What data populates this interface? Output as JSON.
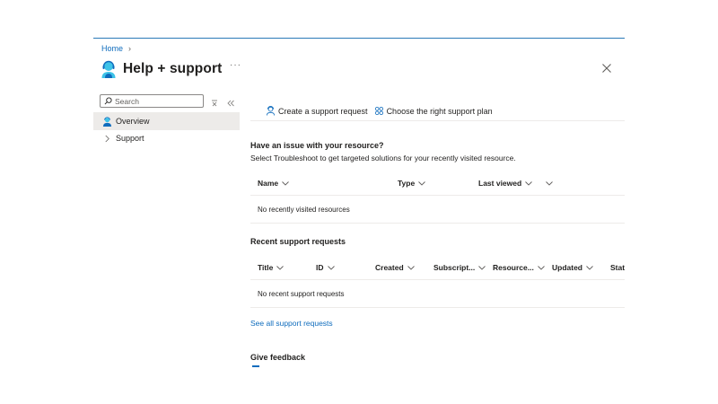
{
  "breadcrumb": {
    "home": "Home",
    "separator": "›"
  },
  "header": {
    "title": "Help + support",
    "more": "···",
    "icon": "support-agent-icon",
    "close_icon": "close-icon"
  },
  "sidebar": {
    "search_placeholder": "Search",
    "clear_icon": "clear-filter-icon",
    "collapse_icon": "double-chevron-left-icon",
    "items": [
      {
        "label": "Overview",
        "icon": "support-agent-icon",
        "active": true
      },
      {
        "label": "Support",
        "icon": "chevron-right-icon",
        "active": false
      }
    ]
  },
  "toolbar": {
    "create_label": "Create a support request",
    "plan_label": "Choose the right support plan"
  },
  "resources": {
    "title": "Have an issue with your resource?",
    "description": "Select Troubleshoot to get targeted solutions for your recently visited resource.",
    "columns": [
      "Name",
      "Type",
      "Last viewed",
      ""
    ],
    "empty_text": "No recently visited resources"
  },
  "requests": {
    "title": "Recent support requests",
    "columns": [
      "Title",
      "ID",
      "Created",
      "Subscript...",
      "Resource...",
      "Updated",
      "Statu"
    ],
    "empty_text": "No recent support requests",
    "see_all": "See all support requests"
  },
  "feedback": {
    "title": "Give feedback"
  },
  "colors": {
    "accent": "#0f6cbd",
    "border": "#edebe9",
    "active_bg": "#edebe9",
    "text": "#201f1e"
  }
}
